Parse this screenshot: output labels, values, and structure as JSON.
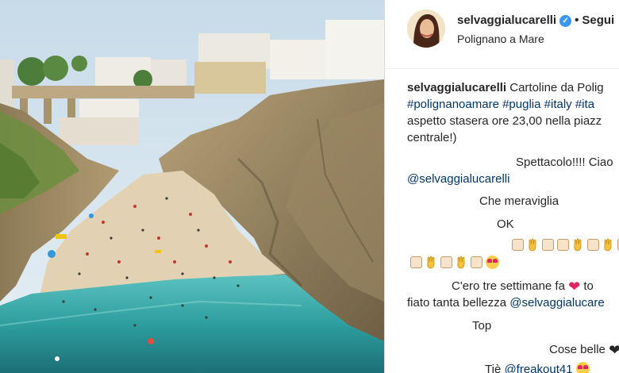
{
  "header": {
    "username": "selvaggialucarelli",
    "verified_badge": "✓",
    "separator": "•",
    "follow_label": "Segui",
    "location": "Polignano a Mare"
  },
  "caption": {
    "user": "selvaggialucarelli",
    "text": "Cartoline da Polig",
    "hashtags": [
      "#polignanoamare",
      "#puglia",
      "#italy",
      "#ita"
    ],
    "line3": "aspetto stasera ore 23,00 nella piazz",
    "line4": "centrale!)"
  },
  "comments": [
    {
      "text": "Spettacolo!!!! Ciao",
      "mention": "@selvaggialucarelli"
    },
    {
      "text": "Che meraviglia"
    },
    {
      "text": "OK"
    },
    {
      "emoji_row": "emoji-row-1"
    },
    {
      "emoji_row": "emoji-row-2"
    },
    {
      "text": "C'ero tre settimane fa",
      "after_heart": " to",
      "line2": "fiato tanta bellezza",
      "mention": "@selvaggialucare"
    },
    {
      "text": "Top"
    },
    {
      "text": "Cose belle"
    },
    {
      "text": "Tiè",
      "mention": "@freakout41"
    }
  ],
  "icons": [
    "verified-badge-icon",
    "heart-icon",
    "heart-eyes-icon",
    "ok-hand-icon",
    "square-emoji-icon"
  ]
}
